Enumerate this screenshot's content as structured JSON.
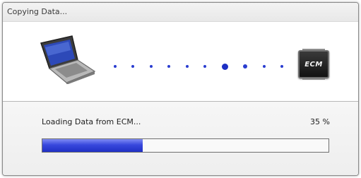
{
  "window": {
    "title": "Copying Data..."
  },
  "transfer": {
    "source_icon": "laptop-icon",
    "target_icon": "ecm-chip-icon",
    "target_label": "ECM",
    "indicator": "dots-animation"
  },
  "status": {
    "message": "Loading Data from ECM...",
    "percent_text": "35 %",
    "progress_fraction": 0.35
  },
  "colors": {
    "progress": "#2a3ad6",
    "dots": "#2a3dd0"
  }
}
